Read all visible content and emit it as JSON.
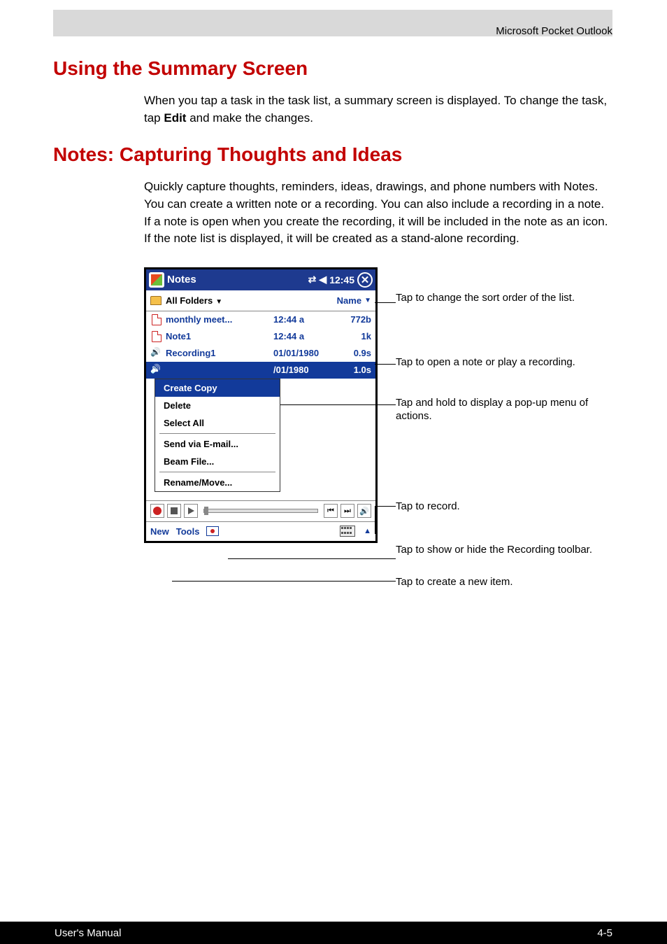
{
  "header": {
    "chapter": "Microsoft Pocket Outlook"
  },
  "section1": {
    "heading": "Using the Summary Screen",
    "para_pre": "When you tap a task in the task list, a summary screen is displayed. To change the task, tap  ",
    "para_bold": "Edit",
    "para_post": " and make the changes."
  },
  "section2": {
    "heading": "Notes: Capturing Thoughts and Ideas",
    "para": "Quickly capture thoughts, reminders, ideas, drawings, and phone numbers with Notes. You can create a written note or a recording. You can also include a recording in a note. If a note is open when you create the recording, it will be included in the note as an icon. If the note list is displayed, it will be created as a stand-alone recording."
  },
  "device": {
    "app_title": "Notes",
    "time": "12:45",
    "folder_label": "All Folders",
    "sort_label": "Name",
    "rows": [
      {
        "name": "monthly meet...",
        "time": "12:44 a",
        "size": "772b",
        "icon": "note"
      },
      {
        "name": "Note1",
        "time": "12:44 a",
        "size": "1k",
        "icon": "note"
      },
      {
        "name": "Recording1",
        "time": "01/01/1980",
        "size": "0.9s",
        "icon": "rec"
      }
    ],
    "partial_row_time": "/01/1980",
    "partial_row_size": "1.0s",
    "context_menu": {
      "items": [
        "Create Copy",
        "Delete",
        "Select All",
        "Send via E-mail...",
        "Beam File...",
        "Rename/Move..."
      ],
      "selected_index": 0
    },
    "menubar": {
      "new": "New",
      "tools": "Tools"
    }
  },
  "callouts": {
    "c1": "Tap to change the sort order of the list.",
    "c2": "Tap to open a note or play a recording.",
    "c3": "Tap and hold to display a pop-up menu of actions.",
    "c4": "Tap to record.",
    "c5": "Tap to show or hide the Recording toolbar.",
    "c6": "Tap to create a new item."
  },
  "footer": {
    "left": "User's Manual",
    "right": "4-5"
  }
}
